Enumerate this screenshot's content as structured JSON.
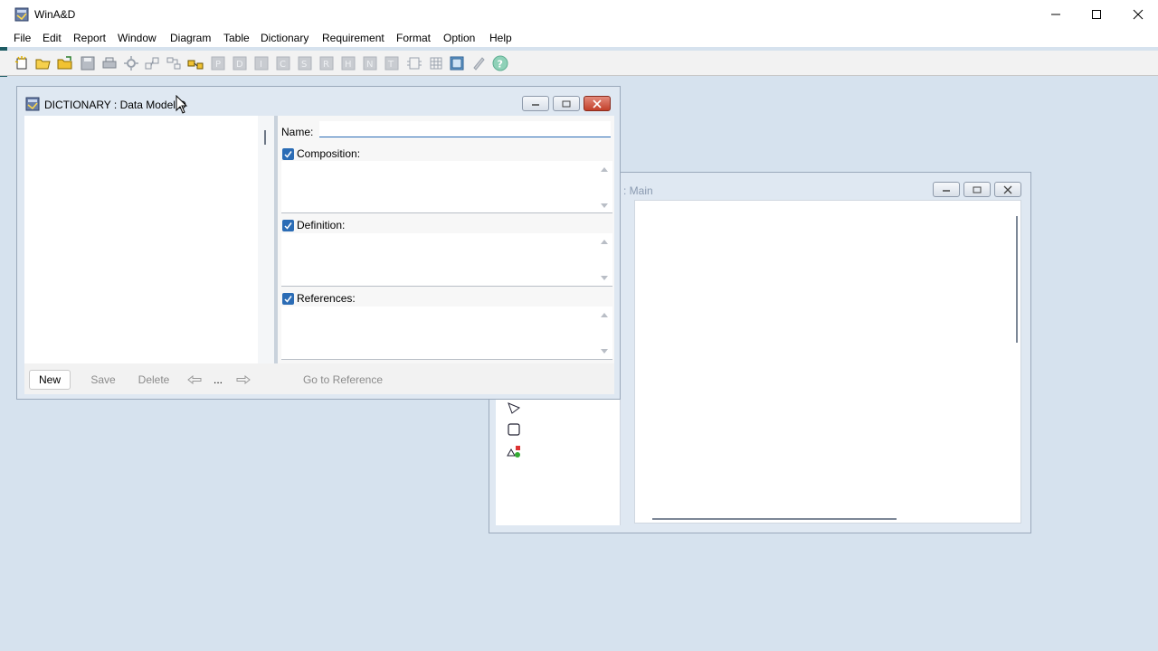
{
  "app": {
    "title": "WinA&D"
  },
  "menu": {
    "items": [
      "File",
      "Edit",
      "Report",
      "Window",
      "Diagram",
      "Table",
      "Dictionary",
      "Requirement",
      "Format",
      "Option",
      "Help"
    ]
  },
  "toolbar": {
    "icons": [
      "new-icon",
      "open-icon",
      "open-folder-icon",
      "save-icon",
      "print-icon",
      "settings-icon",
      "layout-icon",
      "arrange-icon",
      "link-icon",
      "p-icon",
      "d-icon",
      "i-icon",
      "c-icon",
      "s-icon",
      "r-icon",
      "h-icon",
      "n-icon",
      "t-icon",
      "code-gen-icon",
      "code-map-icon",
      "grid-icon",
      "code-pencil-icon",
      "help-icon"
    ]
  },
  "diagram_window": {
    "title": ": Main"
  },
  "dictionary_window": {
    "title": "DICTIONARY : Data Model.D",
    "form": {
      "name_label": "Name:",
      "name_value": "",
      "composition_label": "Composition:",
      "definition_label": "Definition:",
      "references_label": "References:"
    },
    "buttons": {
      "new": "New",
      "save": "Save",
      "delete": "Delete",
      "ellipsis": "...",
      "go_to_reference": "Go to Reference"
    }
  },
  "colors": {
    "accent": "#2b6cb5",
    "desktop": "#d6e2ee",
    "close_button": "#c2402a"
  }
}
